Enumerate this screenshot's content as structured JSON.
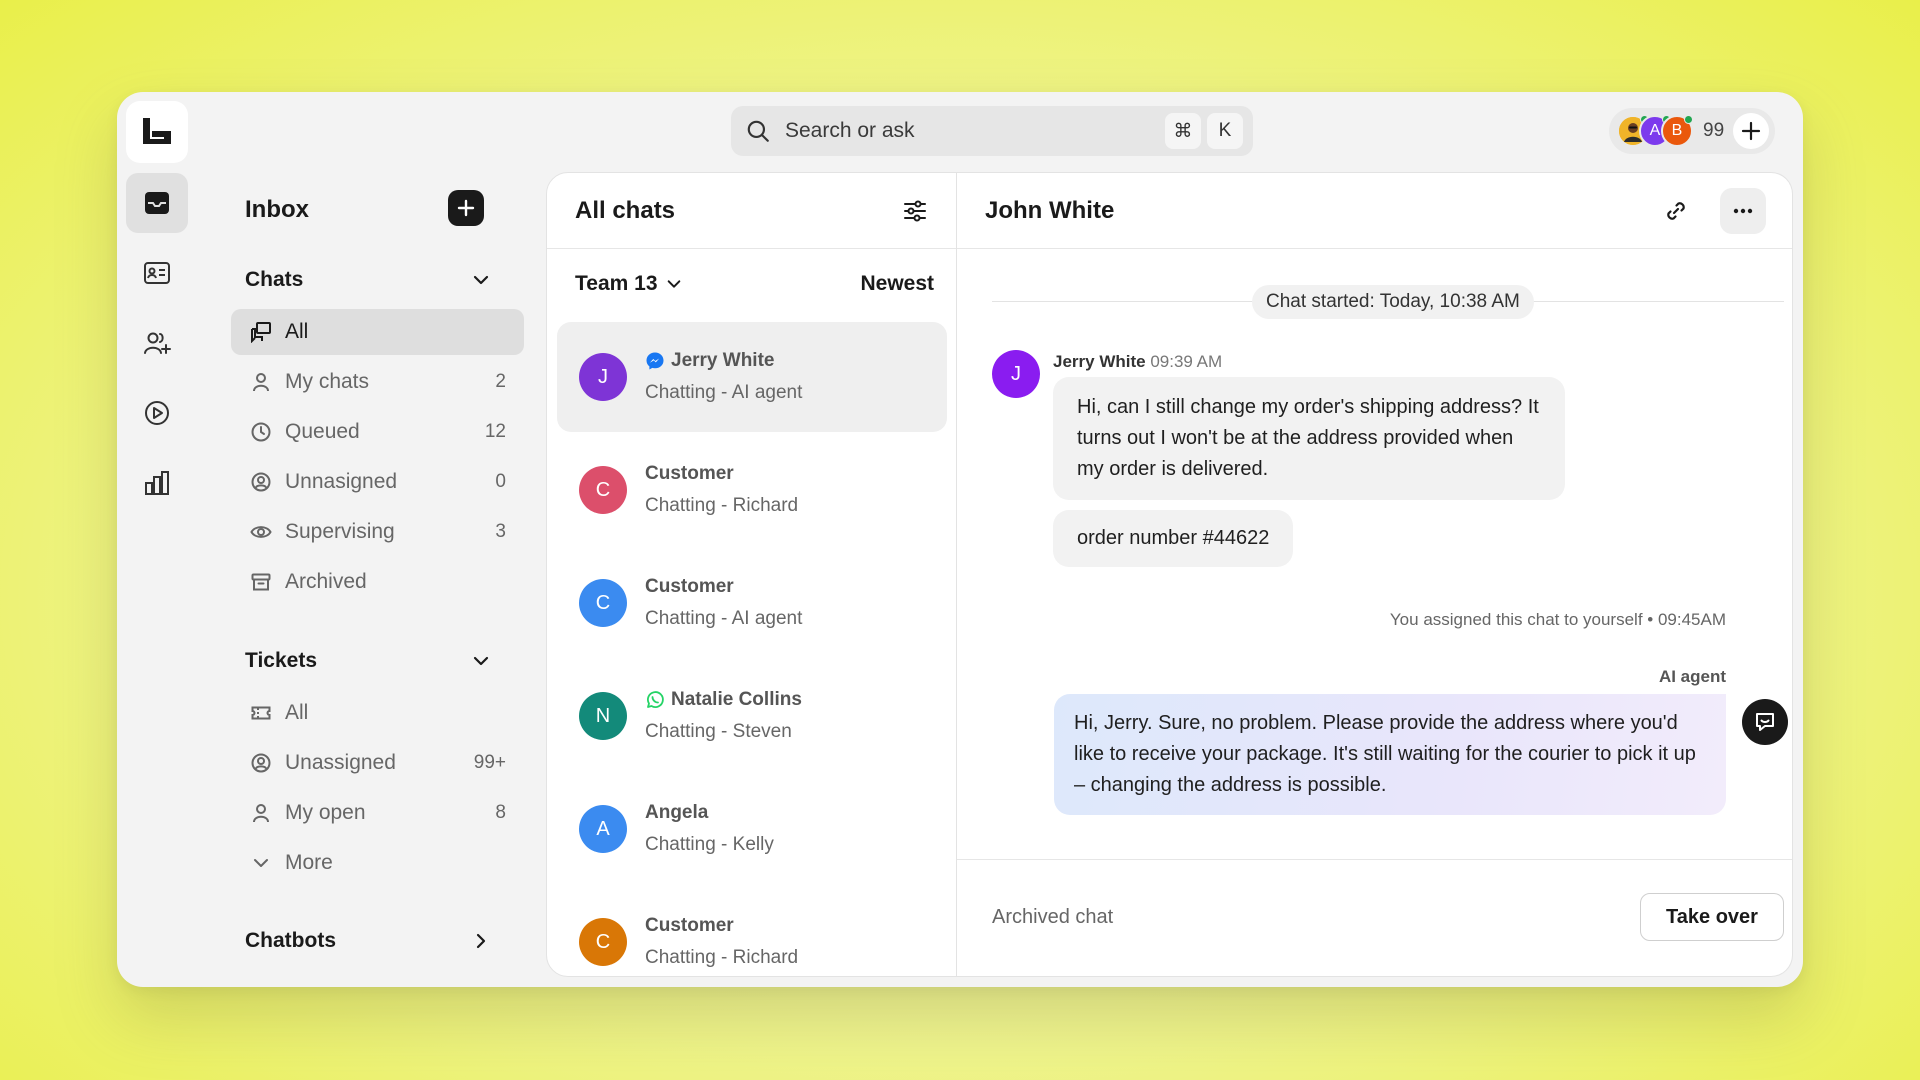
{
  "search": {
    "placeholder": "Search or ask",
    "key1": "⌘",
    "key2": "K"
  },
  "team": {
    "avatars": [
      {
        "initial": "",
        "color": "#f0b429"
      },
      {
        "initial": "A",
        "color": "#7c3aed"
      },
      {
        "initial": "B",
        "color": "#ea580c"
      }
    ],
    "count": "99"
  },
  "sidebar": {
    "title": "Inbox",
    "chats_section": "Chats",
    "chats": [
      {
        "label": "All",
        "count": ""
      },
      {
        "label": "My chats",
        "count": "2"
      },
      {
        "label": "Queued",
        "count": "12"
      },
      {
        "label": "Unnasigned",
        "count": "0"
      },
      {
        "label": "Supervising",
        "count": "3"
      },
      {
        "label": "Archived",
        "count": ""
      }
    ],
    "tickets_section": "Tickets",
    "tickets": [
      {
        "label": "All",
        "count": ""
      },
      {
        "label": "Unassigned",
        "count": "99+"
      },
      {
        "label": "My open",
        "count": "8"
      },
      {
        "label": "More",
        "count": ""
      }
    ],
    "chatbots_section": "Chatbots"
  },
  "chat_list": {
    "title": "All chats",
    "team_filter": "Team 13",
    "sort": "Newest",
    "items": [
      {
        "initial": "J",
        "color": "#7e34d6",
        "name": "Jerry White",
        "channel": "messenger",
        "status": "Chatting - AI agent"
      },
      {
        "initial": "C",
        "color": "#dc4f6b",
        "name": "Customer",
        "channel": "",
        "status": "Chatting - Richard"
      },
      {
        "initial": "C",
        "color": "#3b8bf0",
        "name": "Customer",
        "channel": "",
        "status": "Chatting - AI agent"
      },
      {
        "initial": "N",
        "color": "#138a7a",
        "name": "Natalie Collins",
        "channel": "whatsapp",
        "status": "Chatting - Steven"
      },
      {
        "initial": "A",
        "color": "#3b8bf0",
        "name": "Angela",
        "channel": "",
        "status": "Chatting - Kelly"
      },
      {
        "initial": "C",
        "color": "#d97706",
        "name": "Customer",
        "channel": "",
        "status": "Chatting - Richard"
      }
    ]
  },
  "conversation": {
    "title": "John White",
    "started": "Chat started: Today, 10:38 AM",
    "customer": {
      "initial": "J",
      "color": "#8a1cf0",
      "name": "Jerry White",
      "time": "09:39 AM"
    },
    "message1": "Hi, can I still change my order's shipping address? It turns out I won't be at the address provided when my order is delivered.",
    "message2": "order number #44622",
    "system_note": "You assigned this chat to yourself • 09:45AM",
    "ai_label": "AI agent",
    "ai_message": "Hi, Jerry. Sure, no problem. Please provide the address where you'd like to receive your package. It's still waiting for the courier to pick it up – changing the address is possible.",
    "footer_status": "Archived chat",
    "take_over": "Take over"
  }
}
